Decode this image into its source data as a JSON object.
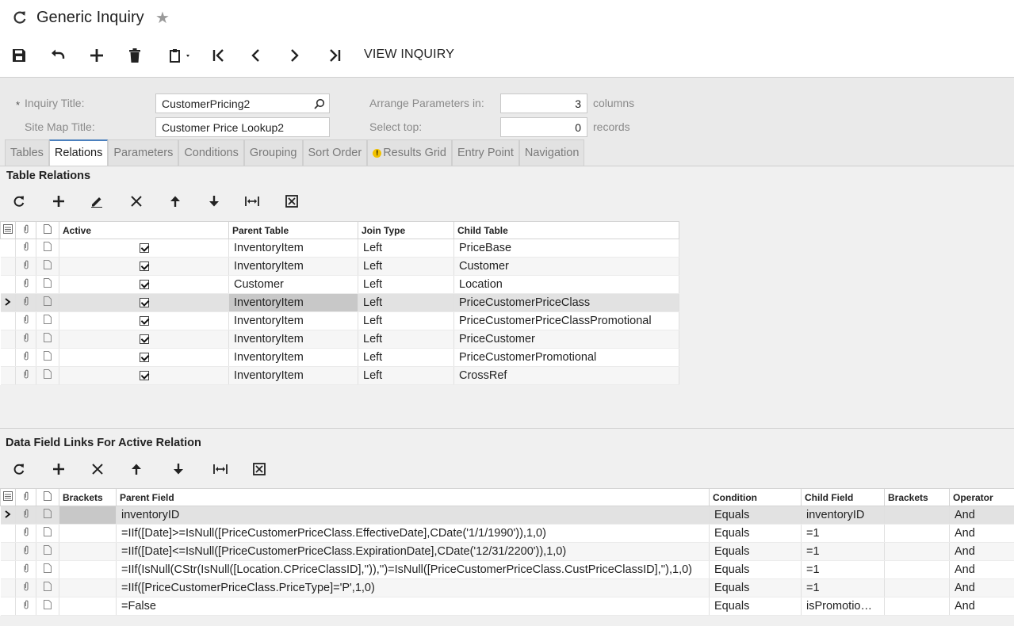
{
  "header": {
    "title": "Generic Inquiry"
  },
  "toolbar": {
    "view_inquiry": "VIEW INQUIRY"
  },
  "form": {
    "inquiry_title_label": "Inquiry Title:",
    "inquiry_title_value": "CustomerPricing2",
    "site_map_title_label": "Site Map Title:",
    "site_map_title_value": "Customer Price Lookup2",
    "arrange_label": "Arrange Parameters in:",
    "arrange_value": "3",
    "arrange_unit": "columns",
    "select_top_label": "Select top:",
    "select_top_value": "0",
    "select_top_unit": "records",
    "required_mark": "*"
  },
  "tabs": [
    "Tables",
    "Relations",
    "Parameters",
    "Conditions",
    "Grouping",
    "Sort Order",
    "Results Grid",
    "Entry Point",
    "Navigation"
  ],
  "relations": {
    "title": "Table Relations",
    "columns": {
      "active": "Active",
      "parent": "Parent Table",
      "join": "Join Type",
      "child": "Child Table"
    },
    "rows": [
      {
        "parent": "InventoryItem",
        "join": "Left",
        "child": "PriceBase"
      },
      {
        "parent": "InventoryItem",
        "join": "Left",
        "child": "Customer"
      },
      {
        "parent": "Customer",
        "join": "Left",
        "child": "Location"
      },
      {
        "parent": "InventoryItem",
        "join": "Left",
        "child": "PriceCustomerPriceClass"
      },
      {
        "parent": "InventoryItem",
        "join": "Left",
        "child": "PriceCustomerPriceClassPromotional"
      },
      {
        "parent": "InventoryItem",
        "join": "Left",
        "child": "PriceCustomer"
      },
      {
        "parent": "InventoryItem",
        "join": "Left",
        "child": "PriceCustomerPromotional"
      },
      {
        "parent": "InventoryItem",
        "join": "Left",
        "child": "CrossRef"
      }
    ]
  },
  "links": {
    "title": "Data Field Links For Active Relation",
    "columns": {
      "brackets1": "Brackets",
      "parent": "Parent Field",
      "condition": "Condition",
      "child": "Child Field",
      "brackets2": "Brackets",
      "operator": "Operator"
    },
    "rows": [
      {
        "parent": "inventoryID",
        "condition": "Equals",
        "child": "inventoryID",
        "operator": "And"
      },
      {
        "parent": "=IIf([Date]>=IsNull([PriceCustomerPriceClass.EffectiveDate],CDate('1/1/1990')),1,0)",
        "condition": "Equals",
        "child": "=1",
        "operator": "And"
      },
      {
        "parent": "=IIf([Date]<=IsNull([PriceCustomerPriceClass.ExpirationDate],CDate('12/31/2200')),1,0)",
        "condition": "Equals",
        "child": "=1",
        "operator": "And"
      },
      {
        "parent": "=IIf(IsNull(CStr(IsNull([Location.CPriceClassID],'')),'')=IsNull([PriceCustomerPriceClass.CustPriceClassID],''),1,0)",
        "condition": "Equals",
        "child": "=1",
        "operator": "And"
      },
      {
        "parent": "=IIf([PriceCustomerPriceClass.PriceType]='P',1,0)",
        "condition": "Equals",
        "child": "=1",
        "operator": "And"
      },
      {
        "parent": "=False",
        "condition": "Equals",
        "child": "isPromotio…",
        "operator": "And"
      }
    ]
  }
}
